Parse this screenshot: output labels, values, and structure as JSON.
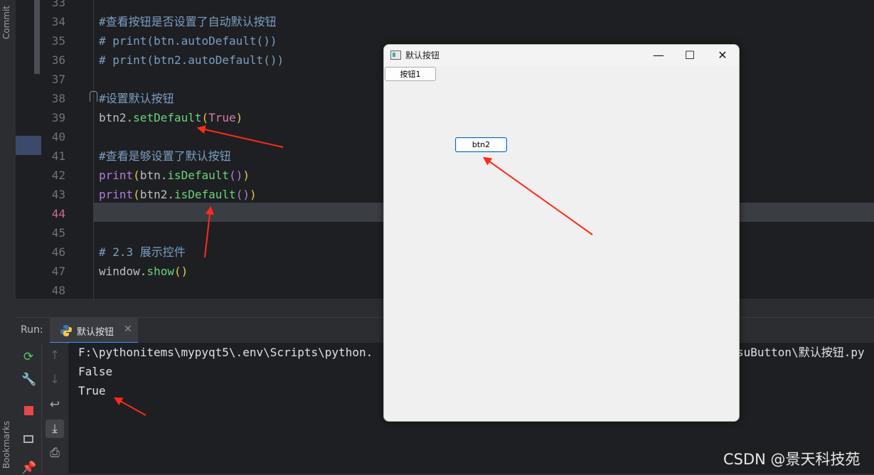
{
  "sidebar": {
    "commit_label": "Commit",
    "bookmarks_label": "Bookmarks"
  },
  "editor": {
    "lines": [
      {
        "num": "33"
      },
      {
        "num": "34",
        "text": "#查看按钮是否设置了自动默认按钮"
      },
      {
        "num": "35",
        "text": "# print(btn.autoDefault())"
      },
      {
        "num": "36",
        "text": "# print(btn2.autoDefault())"
      },
      {
        "num": "37"
      },
      {
        "num": "38",
        "text": "#设置默认按钮"
      },
      {
        "num": "39",
        "obj": "btn2",
        "dot": ".",
        "method": "setDefault",
        "open": "(",
        "arg": "True",
        "close": ")"
      },
      {
        "num": "40"
      },
      {
        "num": "41",
        "text": "#查看是够设置了默认按钮"
      },
      {
        "num": "42",
        "fn": "print",
        "open": "(",
        "obj": "btn",
        "dot": ".",
        "method": "isDefault",
        "call": "()",
        "close": ")"
      },
      {
        "num": "43",
        "fn": "print",
        "open": "(",
        "obj": "btn2",
        "dot": ".",
        "method": "isDefault",
        "call": "()",
        "close": ")"
      },
      {
        "num": "44"
      },
      {
        "num": "45"
      },
      {
        "num": "46",
        "text": "# 2.3 展示控件"
      },
      {
        "num": "47",
        "obj": "window",
        "dot": ".",
        "method": "show",
        "call": "()"
      },
      {
        "num": "48"
      }
    ]
  },
  "run": {
    "label": "Run:",
    "tab_label": "默认按钮",
    "tab_close": "✕",
    "console": {
      "path_left": "F:\\pythonitems\\mypyqt5\\.env\\Scripts\\python.",
      "path_right": "suButton\\默认按钮.py",
      "out1": "False",
      "out2": "True"
    }
  },
  "qt_window": {
    "title": "默认按钮",
    "minimize": "—",
    "maximize": "☐",
    "close": "✕",
    "button1": "按钮1",
    "button2": "btn2"
  },
  "icons": {
    "rerun": "rerun-icon",
    "wrench": "wrench-icon",
    "stop": "stop-icon",
    "layout": "layout-icon",
    "pin": "pin-icon",
    "up": "up-arrow-icon",
    "down": "down-arrow-icon",
    "softwrap": "soft-wrap-icon",
    "scroll-end": "scroll-to-end-icon",
    "print": "print-icon",
    "python": "python-icon"
  },
  "colors": {
    "arrow": "#ff2a1a",
    "accent": "#4a8cff",
    "default_button_border": "#0067c0"
  },
  "watermark": "CSDN @景天科技苑"
}
